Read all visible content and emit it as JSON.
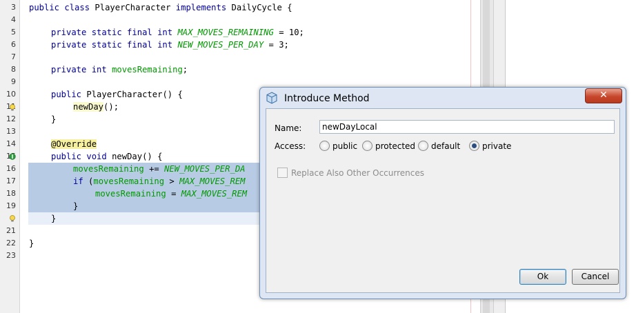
{
  "editor": {
    "line_numbers": [
      "3",
      "4",
      "5",
      "6",
      "7",
      "8",
      "9",
      "10",
      "11",
      "12",
      "13",
      "14",
      "15",
      "16",
      "17",
      "18",
      "19",
      "21",
      "22",
      "23"
    ],
    "lines": {
      "l3": {
        "kw1": "public class ",
        "name": "PlayerCharacter ",
        "kw2": "implements ",
        "iface": "DailyCycle {"
      },
      "l5": {
        "kw": "private static final int ",
        "field": "MAX_MOVES_REMAINING",
        "rest": " = 10;"
      },
      "l6": {
        "kw": "private static final int ",
        "field": "NEW_MOVES_PER_DAY",
        "rest": " = 3;"
      },
      "l8": {
        "kw": "private int ",
        "field": "movesRemaining",
        "rest": ";"
      },
      "l10": {
        "kw": "public ",
        "name": "PlayerCharacter",
        "rest": "() {"
      },
      "l11": {
        "call": "newDay",
        "rest": "();"
      },
      "l12": {
        "text": "}"
      },
      "l14": {
        "ann": "@Override"
      },
      "l15": {
        "kw1": "public ",
        "kw2": "void ",
        "name": "newDay",
        "rest": "() {"
      },
      "l16": {
        "field": "movesRemaining",
        "op": " += ",
        "const": "NEW_MOVES_PER_DA"
      },
      "l17": {
        "kw": "if ",
        "p": "(",
        "field": "movesRemaining",
        "op": " > ",
        "const": "MAX_MOVES_REM"
      },
      "l18": {
        "field": "movesRemaining",
        "op": " = ",
        "const": "MAX_MOVES_REM"
      },
      "l19": {
        "text": "}"
      },
      "l20": {
        "text": "}"
      },
      "l22": {
        "text": "}"
      }
    }
  },
  "dialog": {
    "title": "Introduce Method",
    "close_label": "✕",
    "name_label": "Name:",
    "name_value": "newDayLocal",
    "access_label": "Access:",
    "access_options": [
      "public",
      "protected",
      "default",
      "private"
    ],
    "selected_access": "private",
    "replace_label": "Replace Also Other Occurrences",
    "ok_label": "Ok",
    "cancel_label": "Cancel"
  },
  "colors": {
    "selection": "#b8cbe5",
    "keyword": "#000099",
    "field": "#009900"
  }
}
